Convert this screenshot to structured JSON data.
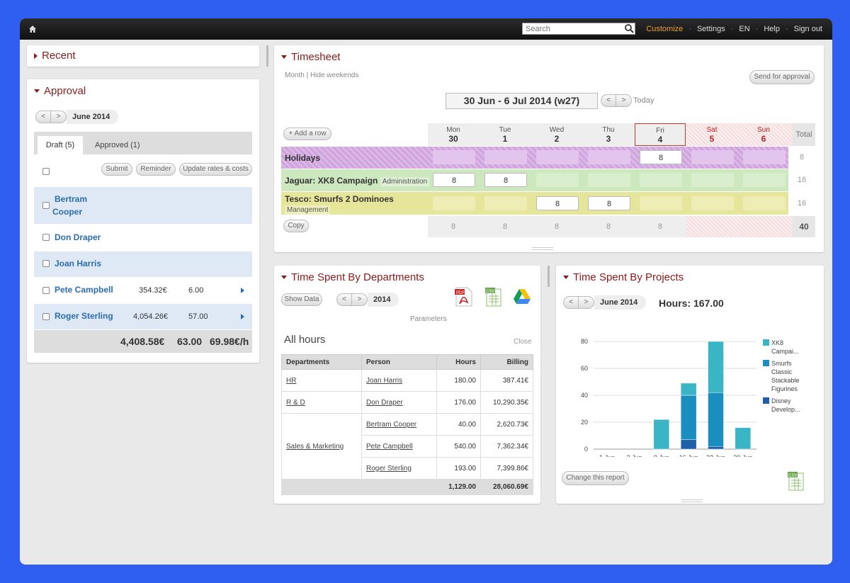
{
  "topbar": {
    "search_placeholder": "Search",
    "nav": [
      "Customize",
      "Settings",
      "EN",
      "Help",
      "Sign out"
    ]
  },
  "recent": {
    "title": "Recent"
  },
  "approval": {
    "title": "Approval",
    "month": "June 2014",
    "tabs": [
      "Draft (5)",
      "Approved (1)"
    ],
    "buttons": [
      "Submit",
      "Reminder",
      "Update rates & costs"
    ],
    "rows": [
      {
        "name_line1": "Bertram",
        "name_line2": "Cooper"
      },
      {
        "name": "Don Draper"
      },
      {
        "name": "Joan Harris"
      },
      {
        "name": "Pete Campbell",
        "amount": "354.32€",
        "hours": "6.00"
      },
      {
        "name": "Roger Sterling",
        "amount": "4,054.26€",
        "hours": "57.00"
      }
    ],
    "totals": {
      "amount": "4,408.58€",
      "hours": "63.00",
      "rate": "69.98€/h"
    }
  },
  "timesheet": {
    "title": "Timesheet",
    "view_links": [
      "Month",
      "Hide weekends"
    ],
    "send_button": "Send for approval",
    "week": "30 Jun - 6 Jul 2014 (w27)",
    "today": "Today",
    "add_row": "+ Add a row",
    "copy": "Copy",
    "total_header": "Total",
    "days": [
      {
        "d": "Mon",
        "n": "30"
      },
      {
        "d": "Tue",
        "n": "1"
      },
      {
        "d": "Wed",
        "n": "2"
      },
      {
        "d": "Thu",
        "n": "3"
      },
      {
        "d": "Fri",
        "n": "4"
      },
      {
        "d": "Sat",
        "n": "5"
      },
      {
        "d": "Sun",
        "n": "6"
      }
    ],
    "rows": [
      {
        "label": "Holidays",
        "total": "8",
        "fri": "8"
      },
      {
        "label": "Jaguar: XK8 Campaign",
        "tag": "Administration",
        "total": "16",
        "mon": "8",
        "tue": "8"
      },
      {
        "label": "Tesco: Smurfs 2 Dominoes",
        "tag": "Management",
        "total": "16",
        "wed": "8",
        "thu": "8"
      }
    ],
    "day_totals": [
      "8",
      "8",
      "8",
      "8",
      "8"
    ],
    "grand_total": "40"
  },
  "departments": {
    "title": "Time Spent By Departments",
    "show_data": "Show Data",
    "year": "2014",
    "parameters": "Parameters",
    "subtitle": "All hours",
    "close": "Close",
    "headers": [
      "Departments",
      "Person",
      "Hours",
      "Billing"
    ],
    "rows": [
      {
        "dept": "HR",
        "person": "Joan Harris",
        "hours": "180.00",
        "billing": "387.41€"
      },
      {
        "dept": "R & D",
        "person": "Don Draper",
        "hours": "176.00",
        "billing": "10,290.35€"
      },
      {
        "dept": "Sales & Marketing",
        "person": "Bertram Cooper",
        "hours": "40.00",
        "billing": "2,620.73€"
      },
      {
        "dept": "",
        "person": "Pete Campbell",
        "hours": "540.00",
        "billing": "7,362.34€"
      },
      {
        "dept": "",
        "person": "Roger Sterling",
        "hours": "193.00",
        "billing": "7,399.86€"
      }
    ],
    "total_hours": "1,129.00",
    "total_billing": "28,060.69€",
    "export_labels": [
      "PDF",
      "CSV"
    ]
  },
  "projects": {
    "title": "Time Spent By Projects",
    "month": "June 2014",
    "hours": "Hours: 167.00",
    "change_report": "Change this report",
    "csv_label": "CSV",
    "chart_data": {
      "type": "bar",
      "stacked": true,
      "categories": [
        "1 Jun",
        "2 Jun",
        "9 Jun",
        "16 Jun",
        "23 Jun",
        "30 Jun"
      ],
      "ylim": [
        0,
        80
      ],
      "yticks": [
        0,
        20,
        40,
        60,
        80
      ],
      "grid": true,
      "legend_position": "right",
      "series": [
        {
          "name": "Disney Develop...",
          "color": "#1f5fa8",
          "values": [
            0,
            0,
            0,
            7,
            2,
            0
          ]
        },
        {
          "name": "Smurfs Classic Stackable Figurines",
          "color": "#1a8fbf",
          "values": [
            0,
            0,
            0,
            33,
            40,
            0
          ]
        },
        {
          "name": "XK8 Campai...",
          "color": "#3ab5c6",
          "values": [
            0,
            0,
            22,
            9,
            38,
            16
          ]
        }
      ],
      "legend": [
        {
          "color": "#3ab5c6",
          "lines": [
            "XK8",
            "Campai..."
          ]
        },
        {
          "color": "#1a8fbf",
          "lines": [
            "Smurfs",
            "Classic",
            "Stackable",
            "Figurines"
          ]
        },
        {
          "color": "#1f5fa8",
          "lines": [
            "Disney",
            "Develop..."
          ]
        }
      ]
    }
  }
}
